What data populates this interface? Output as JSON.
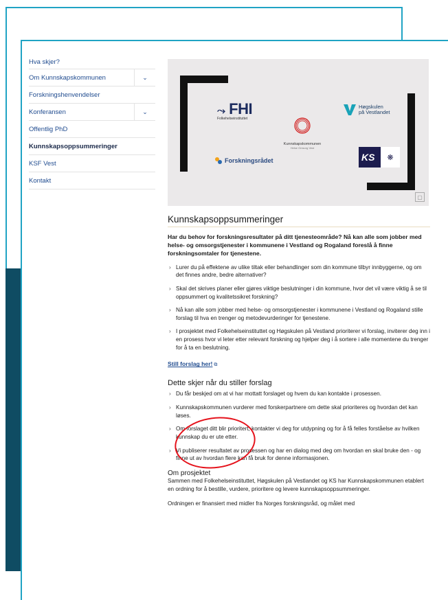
{
  "nav": {
    "items": [
      {
        "label": "Hva skjer?",
        "has_chevron": false,
        "active": false
      },
      {
        "label": "Om Kunnskapskommunen",
        "has_chevron": true,
        "active": false
      },
      {
        "label": "Forskningshenvendelser",
        "has_chevron": false,
        "active": false
      },
      {
        "label": "Konferansen",
        "has_chevron": true,
        "active": false
      },
      {
        "label": "Offentlig PhD",
        "has_chevron": false,
        "active": false
      },
      {
        "label": "Kunnskapsoppsummeringer",
        "has_chevron": false,
        "active": true
      },
      {
        "label": "KSF Vest",
        "has_chevron": false,
        "active": false
      },
      {
        "label": "Kontakt",
        "has_chevron": false,
        "active": false
      }
    ]
  },
  "hero": {
    "fhi_name": "FHI",
    "fhi_sub": "Folkehelseinstituttet",
    "hvl_line1": "Høgskulen",
    "hvl_line2": "på Vestlandet",
    "kk_name": "Kunnskapskommunen",
    "kk_sub": "Helse Omsorg Vest",
    "fr_name": "Forskningsrådet",
    "ks_name": "KS"
  },
  "article": {
    "title": "Kunnskapsoppsummeringer",
    "intro": "Har du behov for forskningsresultater på ditt tjenesteområde? Nå kan alle som jobber med helse- og omsorgstjenester i kommunene i Vestland og Rogaland foreslå å finne forskningsomtaler for tjenestene.",
    "bullets": [
      "Lurer du på effektene av ulike tiltak eller behandlinger som din kommune tilbyr innbyggerne, og om det finnes andre, bedre alternativer?",
      "Skal det skrives planer eller gjøres viktige beslutninger i din kommune, hvor det vil være viktig å se til oppsummert og kvalitetssikret forskning?",
      "Nå kan alle som jobber med helse- og omsorgstjenester i kommunene i Vestland og Rogaland stille forslag til hva en trenger og metodevurderinger for tjenestene.",
      "I prosjektet med Folkehelseinstituttet og Høgskulen på Vestland prioriterer vi forslag, inviterer deg inn i en prosess hvor vi leter etter relevant forskning og hjelper deg i å sortere i alle momentene du trenger for å ta en beslutning."
    ],
    "cta_label": "Still forslag her!",
    "section2_title": "Dette skjer når du stiller forslag",
    "section2_bullets": [
      "Du får beskjed om at vi har mottatt forslaget og hvem du kan kontakte i prosessen.",
      "Kunnskapskommunen vurderer med forskerpartnere om dette skal prioriteres og hvordan det kan løses.",
      "Om forslaget ditt blir prioritert, kontakter vi deg for utdypning og for å få felles forståelse av hvilken kunnskap du er ute etter.",
      "Vi publiserer resultatet av prosessen og har en dialog med deg om hvordan en skal bruke den - og finne ut av hvordan flere kan få bruk for denne informasjonen."
    ],
    "section3_title": "Om prosjektet",
    "section3_p1": "Sammen med Folkehelseinstituttet, Høgskulen på Vestlandet og KS har Kunnskapskommunen etablert en ordning for å bestille, vurdere, prioritere og levere kunnskapsoppsummeringer.",
    "section3_p2": "Ordningen er finansiert med midler fra Norges forskningsråd, og målet med"
  },
  "colors": {
    "accent": "#1fa3c4",
    "link": "#1f4b8f",
    "highlight_circle": "#e5121b",
    "dark_band": "#0f4c63"
  }
}
